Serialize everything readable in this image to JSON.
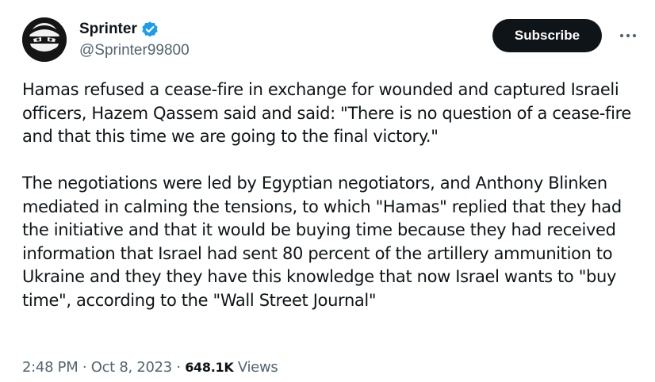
{
  "author": {
    "display_name": "Sprinter",
    "handle": "@Sprinter99800",
    "verified": true,
    "avatar_icon": "ninja-avatar-icon"
  },
  "actions": {
    "subscribe_label": "Subscribe",
    "more_icon": "more-dots-icon"
  },
  "tweet": {
    "paragraphs": [
      "Hamas refused a cease-fire in exchange for wounded and captured Israeli officers, Hazem Qassem said and said: \"There is no question of a cease-fire and that this time we are going to the final victory.\"",
      "The negotiations were led by Egyptian negotiators, and Anthony Blinken mediated in calming the tensions, to which \"Hamas\" replied that they had the initiative and that it would be buying time because they had received information that Israel had sent 80 percent of the artillery ammunition to Ukraine and they they have this knowledge that now Israel wants to \"buy time\", according to the \"Wall Street Journal\""
    ]
  },
  "meta": {
    "time": "2:48 PM",
    "separator": "·",
    "date": "Oct 8, 2023",
    "views_count": "648.1K",
    "views_label": "Views"
  },
  "colors": {
    "text_primary": "#0f1419",
    "text_secondary": "#536471",
    "verified_blue": "#1d9bf0",
    "button_bg": "#0f1419"
  }
}
